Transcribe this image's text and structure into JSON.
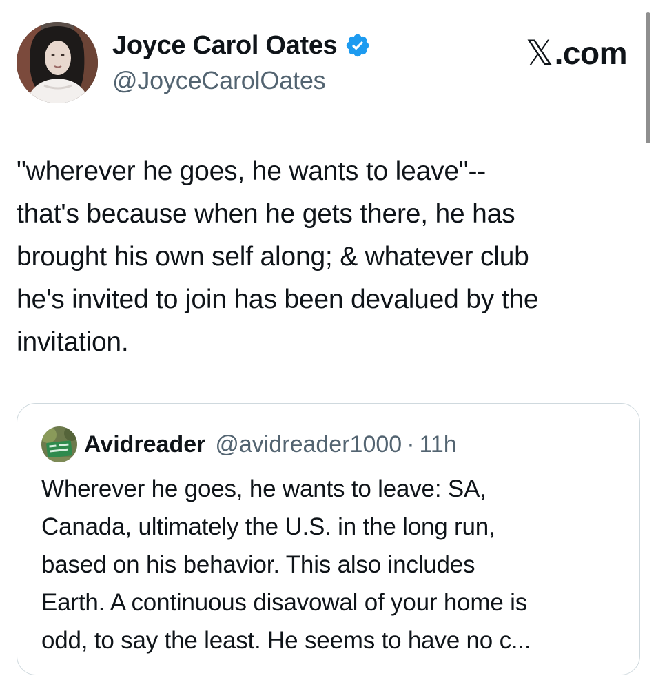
{
  "author": {
    "display_name": "Joyce Carol Oates",
    "handle": "@JoyceCarolOates",
    "verified": true,
    "verified_color": "#1d9bf0"
  },
  "site_label": {
    "glyph": "𝕏",
    "text": ".com"
  },
  "tweet": {
    "lines": [
      "\"wherever he goes, he wants to leave\"--",
      "that's because when he gets there, he has",
      "brought his own self along; & whatever club",
      "he's invited to join has been devalued by the",
      "invitation."
    ]
  },
  "quoted_tweet": {
    "display_name": "Avidreader",
    "handle": "@avidreader1000",
    "separator": "·",
    "time": "11h",
    "lines": [
      "Wherever he goes, he wants to leave: SA,",
      "Canada, ultimately the U.S. in the long run,",
      "based on his behavior. This also includes",
      "Earth. A continuous disavowal of your home is",
      "odd, to say the least. He seems to have no c..."
    ]
  },
  "colors": {
    "text_primary": "#0f1419",
    "text_secondary": "#536471",
    "border": "#cfd9de",
    "accent": "#1d9bf0"
  }
}
